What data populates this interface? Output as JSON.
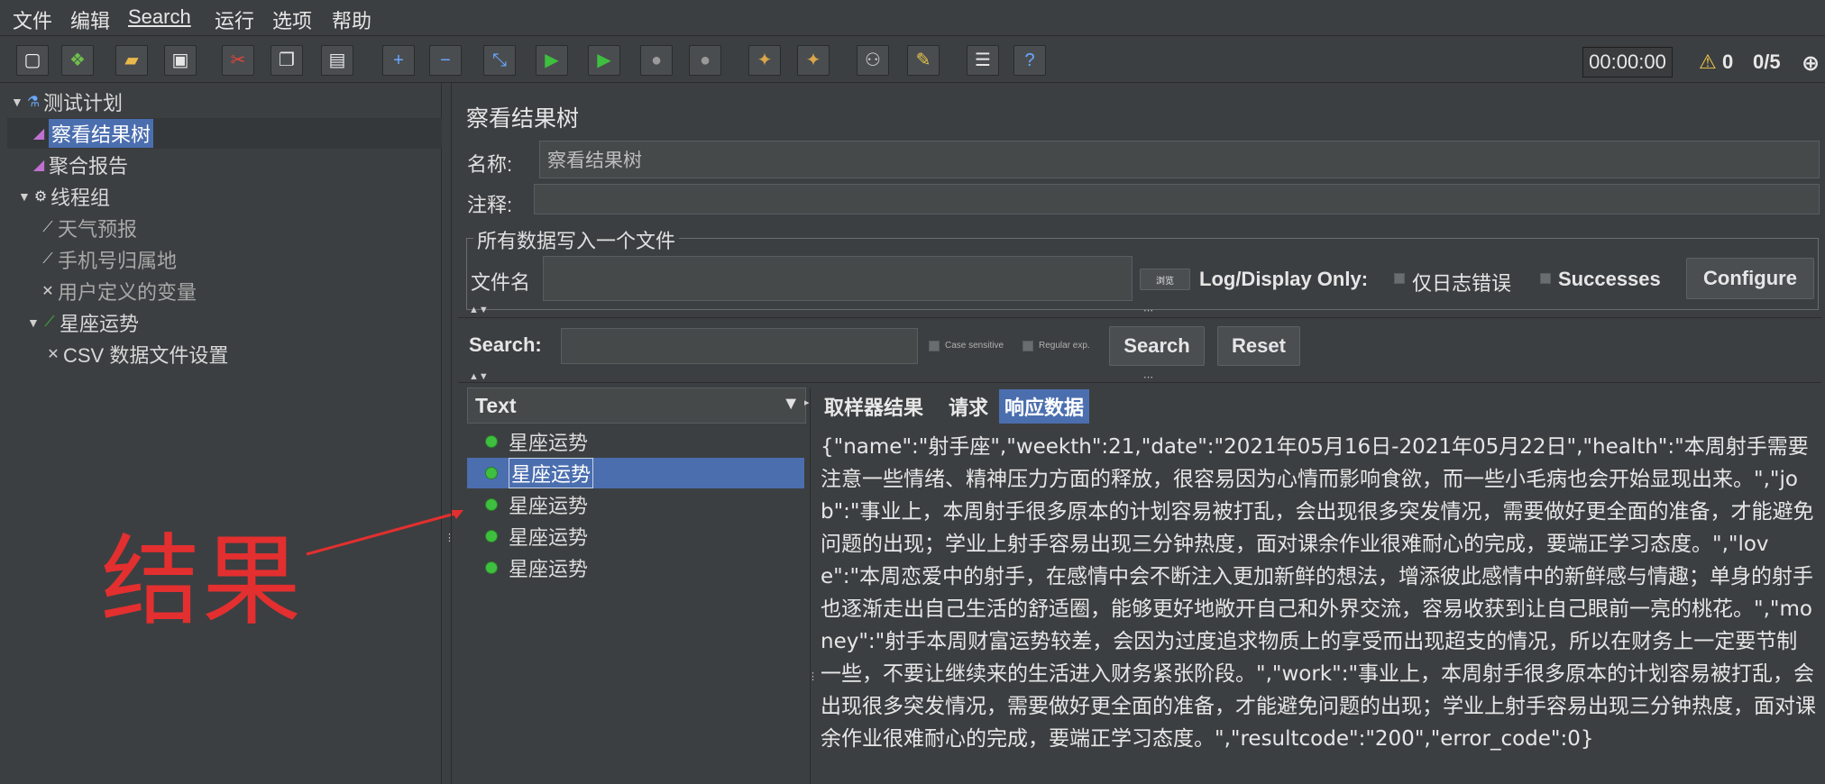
{
  "menu": [
    "文件",
    "编辑",
    "Search",
    "运行",
    "选项",
    "帮助"
  ],
  "toolbar": {
    "timer": "00:00:00",
    "warnings": "0",
    "threads": "0/5",
    "icons": [
      "new-icon",
      "templates-icon",
      "open-icon",
      "save-icon",
      "cut-icon",
      "copy-icon",
      "paste-icon",
      "expand-icon",
      "collapse-icon",
      "toggle-icon",
      "start-icon",
      "start-no-pauses-icon",
      "stop-icon",
      "shutdown-icon",
      "clear-icon",
      "clear-all-icon",
      "search-icon",
      "reset-search-icon",
      "function-helper-icon",
      "help-icon"
    ]
  },
  "tree": {
    "items": [
      {
        "label": "测试计划",
        "icon": "test-plan-icon",
        "expanded": true
      },
      {
        "label": "察看结果树",
        "icon": "listener-icon",
        "selected": true
      },
      {
        "label": "聚合报告",
        "icon": "listener-icon"
      },
      {
        "label": "线程组",
        "icon": "thread-group-icon",
        "expanded": true
      },
      {
        "label": "天气预报",
        "icon": "sampler-icon"
      },
      {
        "label": "手机号归属地",
        "icon": "sampler-icon"
      },
      {
        "label": "用户定义的变量",
        "icon": "config-icon"
      },
      {
        "label": "星座运势",
        "icon": "sampler-icon",
        "expanded": true
      },
      {
        "label": "CSV 数据文件设置",
        "icon": "config-icon"
      }
    ]
  },
  "annotation": {
    "text": "结果",
    "color": "#e32f2f"
  },
  "panel": {
    "title": "察看结果树",
    "name_label": "名称:",
    "name_value": "察看结果树",
    "comment_label": "注释:",
    "comment_value": "",
    "group_title": "所有数据写入一个文件",
    "filename_label": "文件名",
    "filename_value": "",
    "browse_label": "浏览",
    "log_display_label": "Log/Display Only:",
    "errors_label": "仅日志错误",
    "successes_label": "Successes",
    "configure_label": "Configure"
  },
  "search": {
    "label": "Search:",
    "value": "",
    "case_sensitive": "Case sensitive",
    "regular_exp": "Regular exp.",
    "search_button": "Search",
    "reset_button": "Reset"
  },
  "results": {
    "renderer": "Text",
    "items": [
      "星座运势",
      "星座运势",
      "星座运势",
      "星座运势",
      "星座运势"
    ],
    "selected_index": 1
  },
  "tabs": [
    {
      "label": "取样器结果",
      "active": false
    },
    {
      "label": "请求",
      "active": false
    },
    {
      "label": "响应数据",
      "active": true
    }
  ],
  "response_text": "{\"name\":\"射手座\",\"weekth\":21,\"date\":\"2021年05月16日-2021年05月22日\",\"health\":\"本周射手需要注意一些情绪、精神压力方面的释放，很容易因为心情而影响食欲，而一些小毛病也会开始显现出来。\",\"job\":\"事业上，本周射手很多原本的计划容易被打乱，会出现很多突发情况，需要做好更全面的准备，才能避免问题的出现；学业上射手容易出现三分钟热度，面对课余作业很难耐心的完成，要端正学习态度。\",\"love\":\"本周恋爱中的射手，在感情中会不断注入更加新鲜的想法，增添彼此感情中的新鲜感与情趣；单身的射手也逐渐走出自己生活的舒适圈，能够更好地敞开自己和外界交流，容易收获到让自己眼前一亮的桃花。\",\"money\":\"射手本周财富运势较差，会因为过度追求物质上的享受而出现超支的情况，所以在财务上一定要节制一些，不要让继续来的生活进入财务紧张阶段。\",\"work\":\"事业上，本周射手很多原本的计划容易被打乱，会出现很多突发情况，需要做好更全面的准备，才能避免问题的出现；学业上射手容易出现三分钟热度，面对课余作业很难耐心的完成，要端正学习态度。\",\"resultcode\":\"200\",\"error_code\":0}"
}
